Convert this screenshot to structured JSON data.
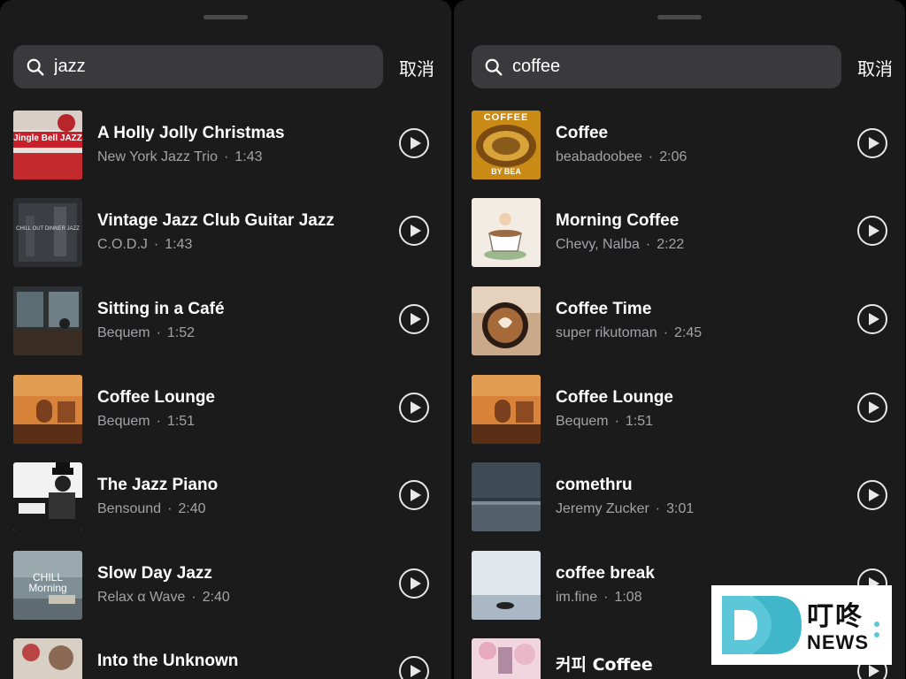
{
  "left_panel": {
    "search": {
      "value": "jazz",
      "placeholder": ""
    },
    "cancel_label": "取消",
    "tracks": [
      {
        "title": "A Holly Jolly Christmas",
        "artist": "New York Jazz Trio",
        "duration": "1:43",
        "cover_text": "Jingle Bell JAZZ"
      },
      {
        "title": "Vintage Jazz Club Guitar Jazz",
        "artist": "C.O.D.J",
        "duration": "1:43",
        "cover_text": "CHILL OUT DINNER JAZZ"
      },
      {
        "title": "Sitting in a Café",
        "artist": "Bequem",
        "duration": "1:52",
        "cover_text": ""
      },
      {
        "title": "Coffee Lounge",
        "artist": "Bequem",
        "duration": "1:51",
        "cover_text": ""
      },
      {
        "title": "The Jazz Piano",
        "artist": "Bensound",
        "duration": "2:40",
        "cover_text": ""
      },
      {
        "title": "Slow Day Jazz",
        "artist": "Relax α Wave",
        "duration": "2:40",
        "cover_text": "CHILL Morning"
      },
      {
        "title": "Into the Unknown",
        "artist": "",
        "duration": "",
        "cover_text": ""
      }
    ]
  },
  "right_panel": {
    "search": {
      "value": "coffee",
      "placeholder": ""
    },
    "cancel_label": "取消",
    "tracks": [
      {
        "title": "Coffee",
        "artist": "beabadoobee",
        "duration": "2:06",
        "cover_text": "COFFEE",
        "cover_text_bottom": "BY BEA"
      },
      {
        "title": "Morning Coffee",
        "artist": "Chevy, Nalba",
        "duration": "2:22",
        "cover_text": ""
      },
      {
        "title": "Coffee Time",
        "artist": "super rikutoman",
        "duration": "2:45",
        "cover_text": ""
      },
      {
        "title": "Coffee Lounge",
        "artist": "Bequem",
        "duration": "1:51",
        "cover_text": ""
      },
      {
        "title": "comethru",
        "artist": "Jeremy Zucker",
        "duration": "3:01",
        "cover_text": ""
      },
      {
        "title": "coffee break",
        "artist": "im.fine",
        "duration": "1:08",
        "cover_text": ""
      },
      {
        "title": "커피 Coffee",
        "artist": "",
        "duration": "",
        "cover_text": ""
      }
    ]
  },
  "watermark": {
    "name_cn": "叮咚",
    "name_en": "NEWS"
  },
  "colors": {
    "background": "#1b1b1c",
    "search_field": "#3a3a3c",
    "secondary_text": "#a3a3a6",
    "watermark_accent": "#5bc7d8"
  }
}
